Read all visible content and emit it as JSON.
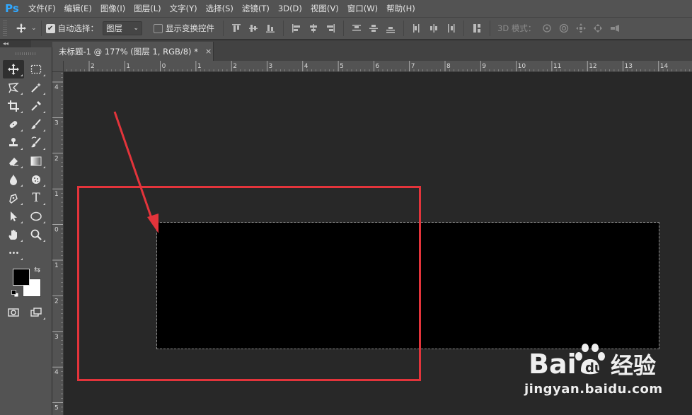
{
  "app": {
    "logo": "Ps"
  },
  "menu": [
    "文件(F)",
    "编辑(E)",
    "图像(I)",
    "图层(L)",
    "文字(Y)",
    "选择(S)",
    "滤镜(T)",
    "3D(D)",
    "视图(V)",
    "窗口(W)",
    "帮助(H)"
  ],
  "options": {
    "auto_select_label": "自动选择：",
    "auto_select_checked": true,
    "auto_select_target": "图层",
    "show_transform_label": "显示变换控件",
    "show_transform_checked": false,
    "mode3d_label": "3D 模式："
  },
  "panel_collapse": "◂◂",
  "document": {
    "tab_title": "未标题-1 @ 177% (图层 1, RGB/8) *",
    "close_glyph": "×"
  },
  "rulers": {
    "horizontal": [
      "2",
      "1",
      "0",
      "1",
      "2",
      "3",
      "4",
      "5",
      "6",
      "7",
      "8",
      "9",
      "10",
      "11",
      "12",
      "13",
      "14"
    ],
    "vertical": [
      "4",
      "3",
      "2",
      "1",
      "0",
      "1",
      "2",
      "3",
      "4",
      "5"
    ]
  },
  "colors": {
    "foreground": "#000000",
    "background": "#ffffff",
    "annotation": "#e3343b",
    "accent_logo": "#31a8ff"
  },
  "tools": [
    [
      "move-tool-icon",
      "marquee-tool-icon"
    ],
    [
      "lasso-tool-icon",
      "magic-wand-tool-icon"
    ],
    [
      "crop-tool-icon",
      "eyedropper-tool-icon"
    ],
    [
      "healing-brush-tool-icon",
      "brush-tool-icon"
    ],
    [
      "clone-stamp-tool-icon",
      "history-brush-tool-icon"
    ],
    [
      "eraser-tool-icon",
      "gradient-tool-icon"
    ],
    [
      "blur-tool-icon",
      "sponge-tool-icon"
    ],
    [
      "pen-tool-icon",
      "type-tool-icon"
    ],
    [
      "path-selection-tool-icon",
      "ellipse-tool-icon"
    ],
    [
      "hand-tool-icon",
      "zoom-tool-icon"
    ]
  ],
  "type_tool_glyph": "T",
  "more_tools_glyph": "•••",
  "swap_glyph": "⇆",
  "watermark": {
    "brand": "Bai",
    "brand_suffix": "du",
    "product": "经验",
    "url": "jingyan.baidu.com"
  }
}
